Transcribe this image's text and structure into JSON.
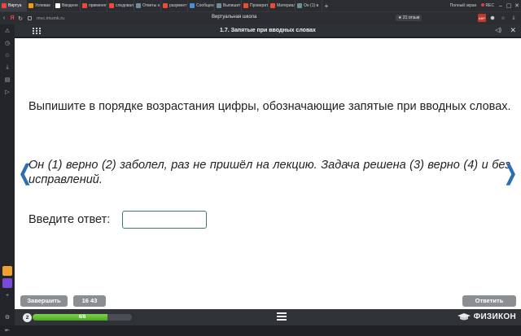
{
  "browser": {
    "tabs": [
      {
        "label": "Виртуа",
        "color": "#e44",
        "active": true
      },
      {
        "label": "Успевае",
        "color": "#f39c12"
      },
      {
        "label": "Вводное",
        "color": "#fff"
      },
      {
        "label": "применял",
        "color": "#e74c3c"
      },
      {
        "label": "следовал",
        "color": "#e74c3c"
      },
      {
        "label": "Ответы н",
        "color": "#6b8e9a"
      },
      {
        "label": "разумеет",
        "color": "#e74c3c"
      },
      {
        "label": "Сообщени",
        "color": "#4a90d9"
      },
      {
        "label": "Выпишит",
        "color": "#6b8e9a"
      },
      {
        "label": "Проверит",
        "color": "#e74c3c"
      },
      {
        "label": "Материал",
        "color": "#e74c3c"
      },
      {
        "label": "Он (1) в",
        "color": "#6b8e9a"
      }
    ],
    "fullscreen_label": "Полный экран",
    "rec_label": "REC",
    "url": "mvc.imumk.ru",
    "page_title": "Виртуальная школа",
    "rating": "★ 21 отзыв"
  },
  "lesson": {
    "title": "1.7. Запятые при вводных словах",
    "question": "Выпишите в порядке возрастания цифры, обозначающие запятые при вводных словах.",
    "passage": "Он (1) верно (2) заболел, раз не пришёл на лекцию. Задача решена (3) верно (4) и без исправлений.",
    "answer_label": "Введите ответ:",
    "answer_value": "",
    "answer_placeholder": ""
  },
  "controls": {
    "finish_label": "Завершить",
    "timer": "16 43",
    "answer_button_label": "Ответить"
  },
  "footer": {
    "level": "2",
    "progress_text": "6/8",
    "progress_fraction": 0.75,
    "brand": "ФИЗИКОН"
  }
}
